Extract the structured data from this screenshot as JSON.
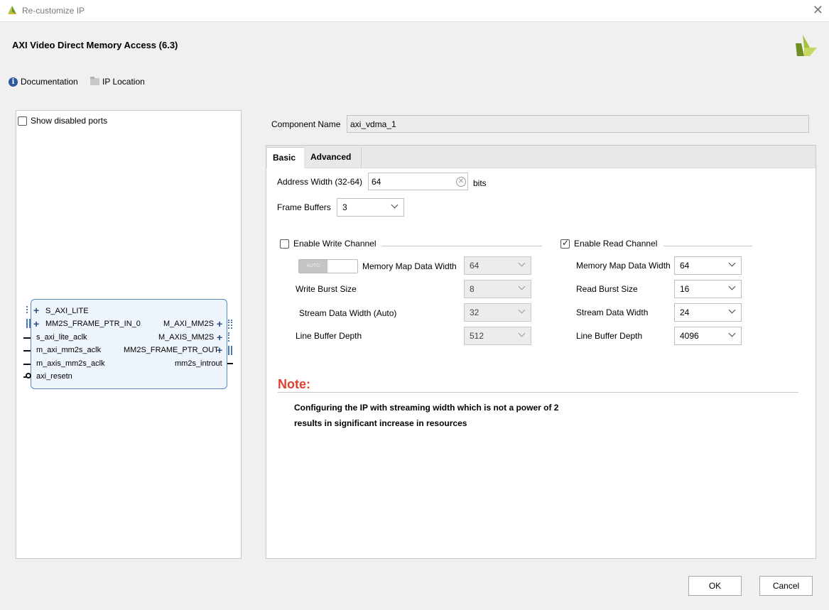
{
  "window": {
    "title": "Re-customize IP"
  },
  "header": {
    "ip_title": "AXI Video Direct Memory Access (6.3)",
    "documentation_label": "Documentation",
    "ip_location_label": "IP Location"
  },
  "left_panel": {
    "show_disabled_ports_label": "Show disabled ports",
    "show_disabled_ports_checked": false,
    "ports_left": [
      "S_AXI_LITE",
      "MM2S_FRAME_PTR_IN_0",
      "s_axi_lite_aclk",
      "m_axi_mm2s_aclk",
      "m_axis_mm2s_aclk",
      "axi_resetn"
    ],
    "ports_right": [
      "M_AXI_MM2S",
      "M_AXIS_MM2S",
      "MM2S_FRAME_PTR_OUT",
      "mm2s_introut"
    ]
  },
  "component": {
    "label": "Component Name",
    "value": "axi_vdma_1"
  },
  "tabs": [
    {
      "label": "Basic",
      "active": true
    },
    {
      "label": "Advanced",
      "active": false
    }
  ],
  "basic": {
    "address_width_label": "Address Width (32-64)",
    "address_width_value": "64",
    "address_width_unit": "bits",
    "frame_buffers_label": "Frame Buffers",
    "frame_buffers_value": "3",
    "write_channel": {
      "enable_label": "Enable Write Channel",
      "enabled": false,
      "auto_toggle_text": "AUTO",
      "mm_data_width_label": "Memory Map Data Width",
      "mm_data_width_value": "64",
      "burst_size_label": "Write Burst Size",
      "burst_size_value": "8",
      "stream_width_label": "Stream Data Width (Auto)",
      "stream_width_value": "32",
      "line_buffer_label": "Line Buffer Depth",
      "line_buffer_value": "512"
    },
    "read_channel": {
      "enable_label": "Enable Read Channel",
      "enabled": true,
      "mm_data_width_label": "Memory Map Data Width",
      "mm_data_width_value": "64",
      "burst_size_label": "Read Burst Size",
      "burst_size_value": "16",
      "stream_width_label": "Stream Data Width",
      "stream_width_value": "24",
      "line_buffer_label": "Line Buffer Depth",
      "line_buffer_value": "4096"
    },
    "note": {
      "title": "Note:",
      "line1": "Configuring the IP with streaming width which is not a power of 2",
      "line2": "results in significant increase in resources"
    }
  },
  "buttons": {
    "ok": "OK",
    "cancel": "Cancel"
  },
  "colors": {
    "note_red": "#e04030",
    "block_fill": "#eef4fb",
    "block_border": "#5b89c4",
    "logo_green": "#8fb23a"
  }
}
